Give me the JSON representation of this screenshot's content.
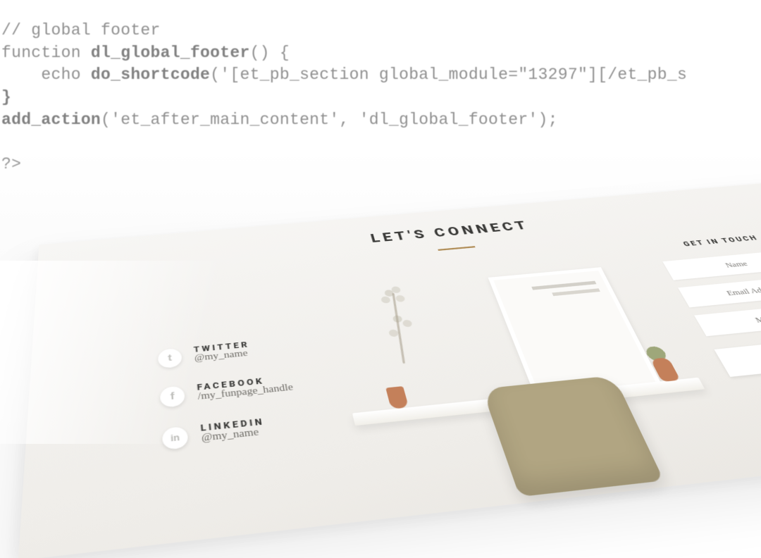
{
  "code": {
    "line1_a": "// global footer",
    "line2_a": "function ",
    "line2_b": "dl_global_footer",
    "line2_c": "() {",
    "line3_a": "    echo ",
    "line3_b": "do_shortcode",
    "line3_c": "('[et_pb_section global_module=\"13297\"][/et_pb_s",
    "line4_a": "}",
    "line5_a": "add_action",
    "line5_b": "('et_after_main_content', 'dl_global_footer');",
    "line6_a": "?>"
  },
  "footer": {
    "headline": "LET'S CONNECT",
    "social": [
      {
        "icon": "t",
        "label": "TWITTER",
        "handle": "@my_name"
      },
      {
        "icon": "f",
        "label": "FACEBOOK",
        "handle": "/my_funpage_handle"
      },
      {
        "icon": "in",
        "label": "LINKEDIN",
        "handle": "@my_name"
      }
    ],
    "form": {
      "title": "GET IN TOUCH",
      "name": "Name",
      "email": "Email Address",
      "message": "Message"
    }
  }
}
